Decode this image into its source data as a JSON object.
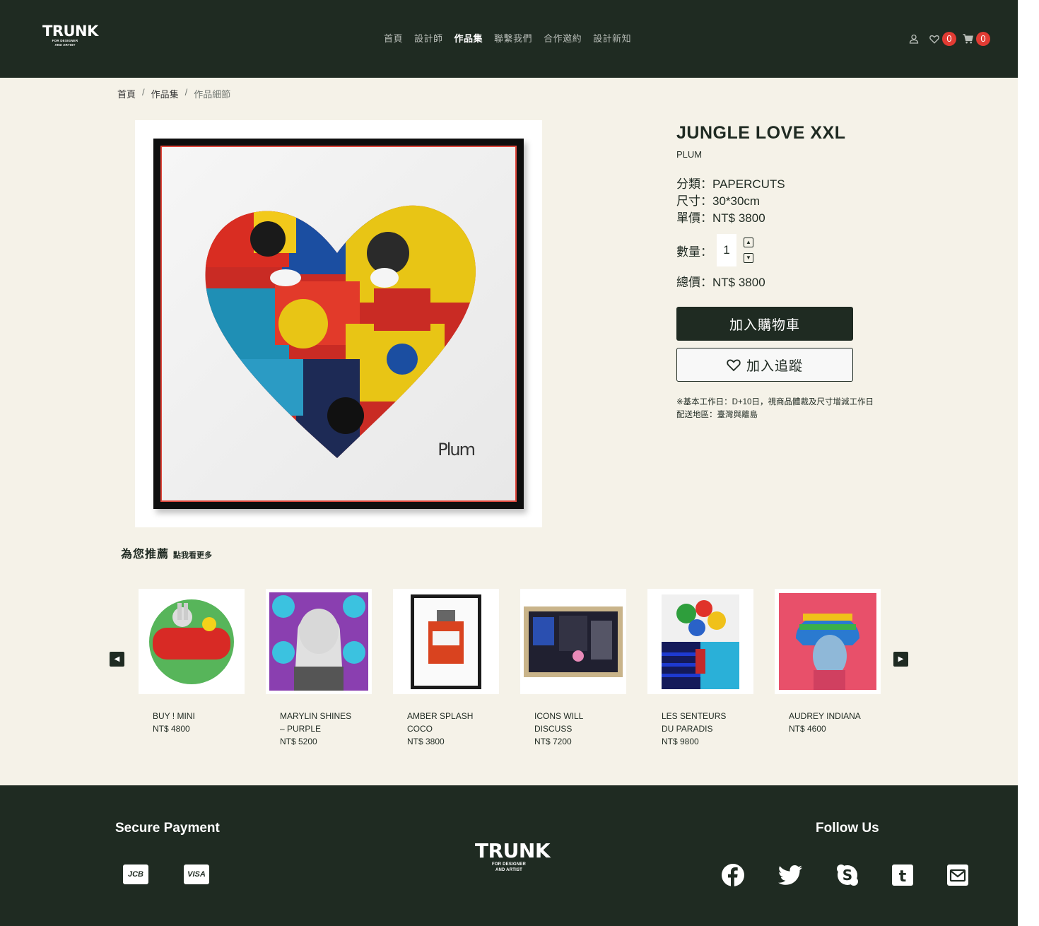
{
  "header": {
    "logo_text": "TRUNK",
    "logo_tagline_1": "FOR DESIGNER",
    "logo_tagline_2": "AND ARTIST",
    "nav": [
      "首頁",
      "設計師",
      "作品集",
      "聯繫我們",
      "合作邀約",
      "設計新知"
    ],
    "active_nav": "作品集",
    "wishlist_count": "0",
    "cart_count": "0"
  },
  "breadcrumb": [
    "首頁",
    "作品集",
    "作品細節"
  ],
  "product": {
    "title": "JUNGLE LOVE XXL",
    "artist": "PLUM",
    "signature": "Plum",
    "category_line": "分類：PAPERCUTS",
    "size_line": "尺寸：30*30cm",
    "price_line": "單價：NT$ 3800",
    "qty_label": "數量：",
    "qty_value": "1",
    "total_line": "總價：NT$ 3800",
    "add_cart_label": "加入購物車",
    "follow_label": "加入追蹤",
    "note_1": "※基本工作日：D+10日，視商品體裁及尺寸增減工作日",
    "note_2": "配送地區：臺灣與離島"
  },
  "recommend": {
    "title": "為您推薦",
    "more": "點我看更多",
    "items": [
      {
        "name": "BUY ! MINI",
        "price": "NT$ 4800"
      },
      {
        "name": "MARYLIN SHINES – PURPLE",
        "price": "NT$ 5200"
      },
      {
        "name": "AMBER SPLASH COCO",
        "price": "NT$ 3800"
      },
      {
        "name": "ICONS WILL DISCUSS",
        "price": "NT$ 7200"
      },
      {
        "name": "LES SENTEURS DU PARADIS",
        "price": "NT$ 9800"
      },
      {
        "name": "AUDREY INDIANA",
        "price": "NT$ 4600"
      }
    ]
  },
  "footer": {
    "payment_title": "Secure Payment",
    "payment_methods": [
      "JCB",
      "VISA"
    ],
    "logo_text": "TRUNK",
    "logo_tagline_1": "FOR DESIGNER",
    "logo_tagline_2": "AND ARTIST",
    "follow_title": "Follow Us",
    "socials": [
      "facebook-icon",
      "twitter-icon",
      "skype-icon",
      "tumblr-icon",
      "mail-icon"
    ]
  },
  "colors": {
    "primary": "#1f2b22",
    "background": "#f5f2e8",
    "badge": "#e23b33"
  }
}
